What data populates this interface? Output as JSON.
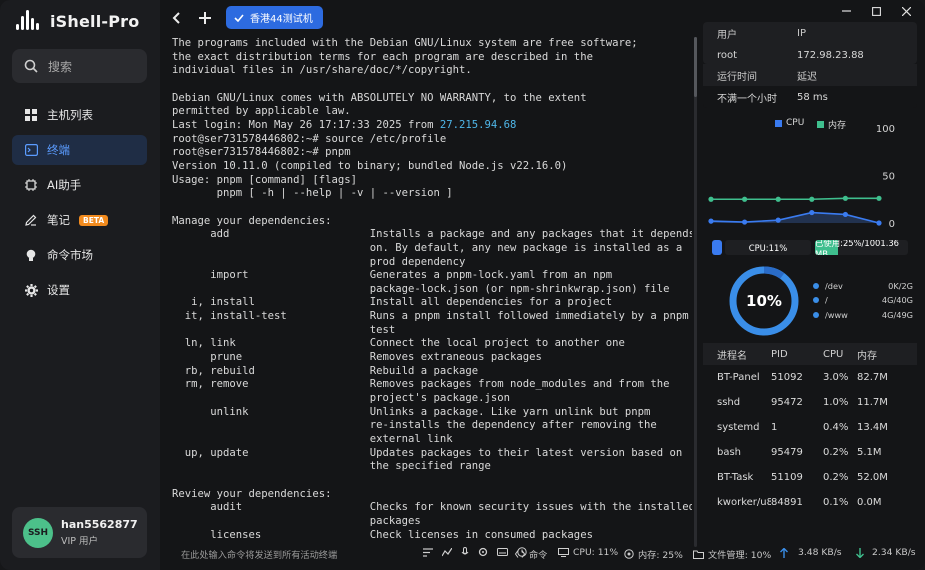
{
  "app": {
    "title": "iShell-Pro"
  },
  "sidebar": {
    "search_label": "搜索",
    "items": [
      {
        "label": "主机列表",
        "icon": "grid-icon"
      },
      {
        "label": "终端",
        "icon": "terminal-icon"
      },
      {
        "label": "AI助手",
        "icon": "ai-icon"
      },
      {
        "label": "笔记",
        "icon": "edit-icon",
        "badge": "BETA"
      },
      {
        "label": "命令市场",
        "icon": "bulb-icon"
      },
      {
        "label": "设置",
        "icon": "gear-icon"
      }
    ],
    "user": {
      "avatar": "SSH",
      "name": "han5562877",
      "role": "VIP 用户"
    }
  },
  "tabs": [
    {
      "label": "香港44测试机"
    }
  ],
  "terminal": {
    "lines": [
      "The programs included with the Debian GNU/Linux system are free software;",
      "the exact distribution terms for each program are described in the",
      "individual files in /usr/share/doc/*/copyright.",
      "",
      "Debian GNU/Linux comes with ABSOLUTELY NO WARRANTY, to the extent",
      "permitted by applicable law.",
      "Last login: Mon May 26 17:17:33 2025 from ",
      "root@ser731578446802:~# source /etc/profile",
      "root@ser731578446802:~# pnpm",
      "Version 10.11.0 (compiled to binary; bundled Node.js v22.16.0)",
      "Usage: pnpm [command] [flags]",
      "       pnpm [ -h | --help | -v | --version ]",
      "",
      "Manage your dependencies:",
      "      add                      Installs a package and any packages that it depends",
      "                               on. By default, any new package is installed as a",
      "                               prod dependency",
      "      import                   Generates a pnpm-lock.yaml from an npm",
      "                               package-lock.json (or npm-shrinkwrap.json) file",
      "   i, install                  Install all dependencies for a project",
      "  it, install-test             Runs a pnpm install followed immediately by a pnpm",
      "                               test",
      "  ln, link                     Connect the local project to another one",
      "      prune                    Removes extraneous packages",
      "  rb, rebuild                  Rebuild a package",
      "  rm, remove                   Removes packages from node_modules and from the",
      "                               project's package.json",
      "      unlink                   Unlinks a package. Like yarn unlink but pnpm",
      "                               re-installs the dependency after removing the",
      "                               external link",
      "  up, update                   Updates packages to their latest version based on",
      "                               the specified range",
      "",
      "Review your dependencies:",
      "      audit                    Checks for known security issues with the installed",
      "                               packages",
      "      licenses                 Check licenses in consumed packages"
    ],
    "last_login_ip": "27.215.94.68"
  },
  "info": {
    "user_header": "用户",
    "ip_header": "IP",
    "user": "root",
    "ip": "172.98.23.88",
    "uptime_header": "运行时间",
    "latency_header": "延迟",
    "uptime": "不满一个小时",
    "latency": "58 ms"
  },
  "chart_data": {
    "type": "line",
    "series": [
      {
        "name": "CPU",
        "color": "#3a7bf0",
        "values": [
          2,
          1,
          3,
          11,
          9,
          0
        ]
      },
      {
        "name": "内存",
        "color": "#3fbf8e",
        "values": [
          25,
          25,
          25,
          25,
          26,
          26
        ]
      }
    ],
    "ylim": [
      0,
      100
    ],
    "yticks": [
      "100",
      "50",
      "0"
    ]
  },
  "usage": {
    "cpu_label": "CPU:11%",
    "cpu_percent": 11,
    "mem_label": "已使用:25%/1001.36 MB",
    "mem_percent": 25
  },
  "disk": {
    "gauge_label": "10%",
    "gauge_percent": 10,
    "rows": [
      {
        "path": "/dev",
        "value": "0K/2G"
      },
      {
        "path": "/",
        "value": "4G/40G"
      },
      {
        "path": "/www",
        "value": "4G/49G"
      }
    ]
  },
  "processes": {
    "headers": [
      "进程名",
      "PID",
      "CPU",
      "内存"
    ],
    "rows": [
      {
        "name": "BT-Panel",
        "pid": "51092",
        "cpu": "3.0%",
        "mem": "82.7M"
      },
      {
        "name": "sshd",
        "pid": "95472",
        "cpu": "1.0%",
        "mem": "11.7M"
      },
      {
        "name": "systemd",
        "pid": "1",
        "cpu": "0.4%",
        "mem": "13.4M"
      },
      {
        "name": "bash",
        "pid": "95479",
        "cpu": "0.2%",
        "mem": "5.1M"
      },
      {
        "name": "BT-Task",
        "pid": "51109",
        "cpu": "0.2%",
        "mem": "52.0M"
      },
      {
        "name": "kworker/u8:...",
        "pid": "84891",
        "cpu": "0.1%",
        "mem": "0.0M"
      }
    ]
  },
  "statusbar": {
    "input_placeholder": "在此处输入命令将发送到所有活动终端",
    "cmd": "命令",
    "cpu": "CPU: 11%",
    "mem": "内存: 25%",
    "files": "文件管理: 10%",
    "up": "3.48 KB/s",
    "down": "2.34 KB/s"
  }
}
